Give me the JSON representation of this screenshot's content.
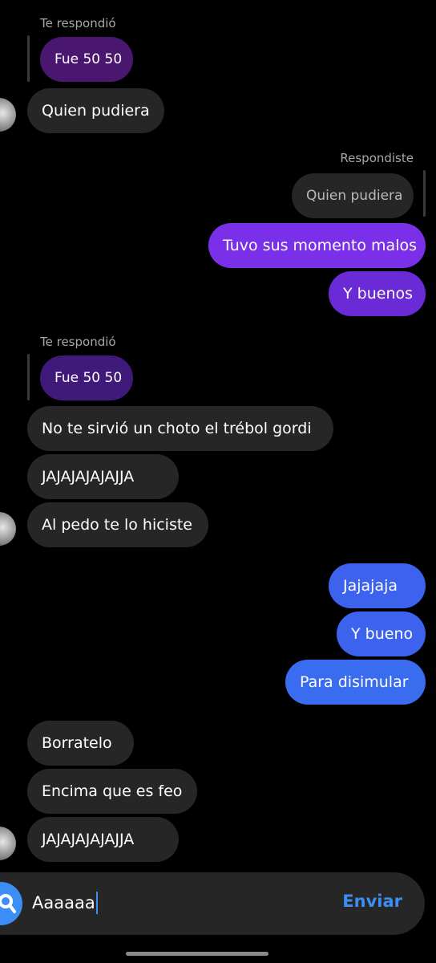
{
  "messages": {
    "reply1": {
      "label": "Te respondió",
      "quoted": "Fue 50 50"
    },
    "m1": "Quien pudiera",
    "reply2": {
      "label": "Respondiste",
      "quoted": "Quien pudiera"
    },
    "m2": "Tuvo sus momento malos",
    "m3": "Y buenos",
    "reply3": {
      "label": "Te respondió",
      "quoted": "Fue 50 50"
    },
    "m4": "No te sirvió un choto el trébol gordi",
    "m5": "JAJAJAJAJAJJA",
    "m6": "Al pedo te lo hiciste",
    "m7": "Jajajaja",
    "m8": "Y bueno",
    "m9": "Para disimular",
    "m10": "Borratelo",
    "m11": "Encima que es feo",
    "m12": "JAJAJAJAJAJJA"
  },
  "composer": {
    "input_value": "Aaaaaa",
    "send_label": "Enviar",
    "search_icon": "search-icon"
  },
  "colors": {
    "background": "#000000",
    "incoming_bubble": "#262626",
    "outgoing_purple": "#7a30e8",
    "outgoing_blue": "#3d63ee",
    "accent": "#3b8ef5"
  }
}
